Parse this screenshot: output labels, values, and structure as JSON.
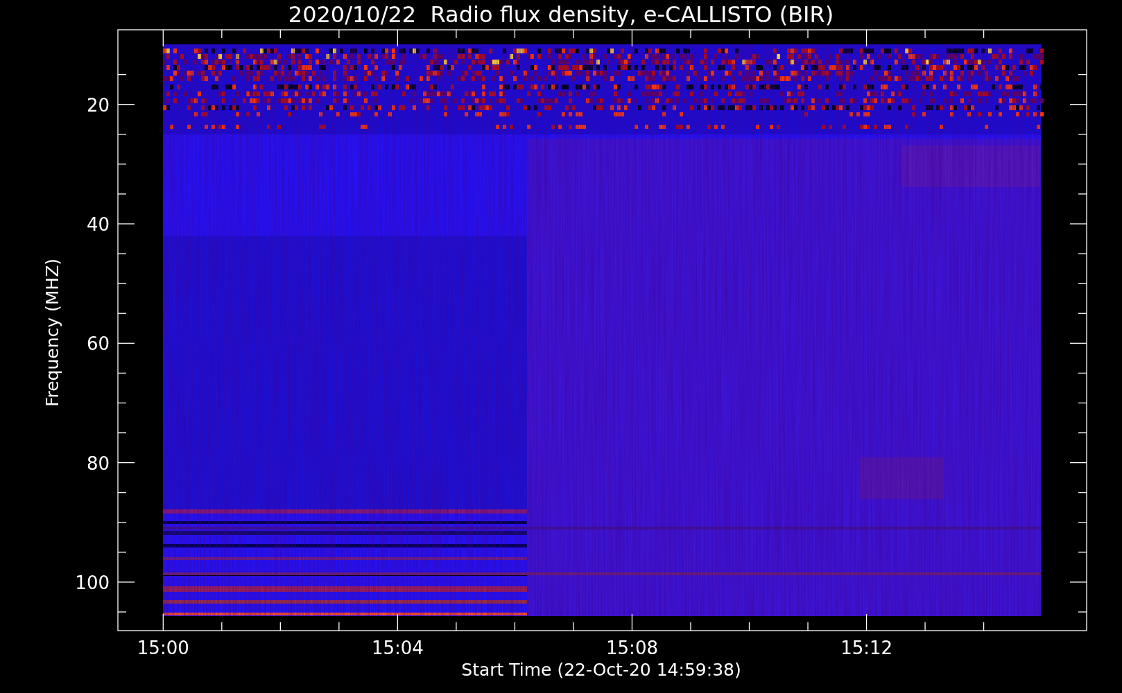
{
  "title": "2020/10/22  Radio flux density, e-CALLISTO (BIR)",
  "y_axis": {
    "label": "Frequency (MHZ)",
    "ticks": [
      "20",
      "40",
      "60",
      "80",
      "100"
    ]
  },
  "x_axis": {
    "label": "Start Time (22-Oct-20 14:59:38)",
    "ticks": [
      "15:00",
      "15:04",
      "15:08",
      "15:12"
    ]
  }
}
